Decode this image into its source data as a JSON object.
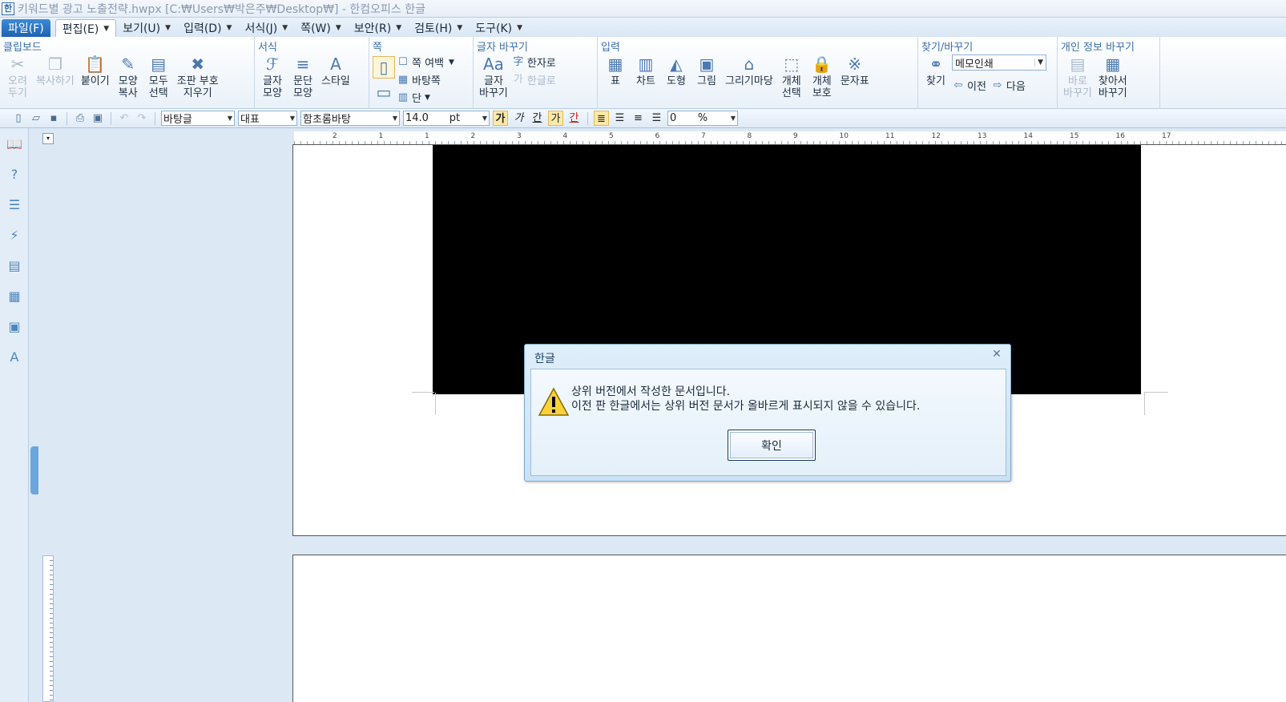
{
  "window": {
    "title": "키워드별 광고 노출전략.hwpx [C:₩Users₩박은주₩Desktop₩] - 한컴오피스 한글",
    "logo": "app-logo-icon"
  },
  "menu": {
    "file": "파일(F)",
    "items": [
      "편집(E)",
      "보기(U)",
      "입력(D)",
      "서식(J)",
      "쪽(W)",
      "보안(R)",
      "검토(H)",
      "도구(K)"
    ]
  },
  "ribbon": {
    "clipboard": {
      "title": "클립보드",
      "buttons": [
        {
          "label": "오려\n두기",
          "icon": "scissors-icon",
          "glyph": "✂"
        },
        {
          "label": "복사하기",
          "icon": "copy-icon",
          "glyph": "❐"
        },
        {
          "label": "붙이기",
          "icon": "paste-icon",
          "glyph": "📋"
        },
        {
          "label": "모양\n복사",
          "icon": "format-painter-icon",
          "glyph": "✎"
        },
        {
          "label": "모두\n선택",
          "icon": "select-all-icon",
          "glyph": "▤"
        },
        {
          "label": "조판 부호\n지우기",
          "icon": "clear-marks-icon",
          "glyph": "✖"
        }
      ]
    },
    "format": {
      "title": "서식",
      "buttons": [
        {
          "label": "글자\n모양",
          "icon": "char-shape-icon",
          "glyph": "ℱ"
        },
        {
          "label": "문단\n모양",
          "icon": "para-shape-icon",
          "glyph": "≡"
        },
        {
          "label": "스타일",
          "icon": "style-icon",
          "glyph": "A"
        }
      ]
    },
    "page": {
      "title": "쪽",
      "margin": "쪽 여백",
      "background": "바탕쪽",
      "columns": "단"
    },
    "char_replace": {
      "title": "글자 바꾸기",
      "button": "글자\n바꾸기",
      "hanja": "한자로",
      "hangul": "한글로"
    },
    "input": {
      "title": "입력",
      "buttons": [
        {
          "label": "표",
          "icon": "table-icon",
          "glyph": "▦"
        },
        {
          "label": "차트",
          "icon": "chart-icon",
          "glyph": "▥"
        },
        {
          "label": "도형",
          "icon": "shape-icon",
          "glyph": "◭"
        },
        {
          "label": "그림",
          "icon": "picture-icon",
          "glyph": "▣"
        },
        {
          "label": "그리기마당",
          "icon": "clipart-icon",
          "glyph": "⌂"
        },
        {
          "label": "개체\n선택",
          "icon": "object-select-icon",
          "glyph": "⬚"
        },
        {
          "label": "개체\n보호",
          "icon": "object-protect-icon",
          "glyph": "🔒"
        },
        {
          "label": "문자표",
          "icon": "symbol-icon",
          "glyph": "※"
        }
      ]
    },
    "find": {
      "title": "찾기/바꾸기",
      "find": "찾기",
      "memo_value": "메모인쇄",
      "prev": "이전",
      "next": "다음"
    },
    "privacy": {
      "title": "개인 정보 바꾸기",
      "direct": "바로\n바꾸기",
      "search": "찾아서\n바꾸기"
    }
  },
  "format_toolbar": {
    "style": "바탕글",
    "lang": "대표",
    "font": "함초롬바탕",
    "size": "14.0",
    "size_unit": "pt",
    "bold": "가",
    "italic": "가",
    "underline": "간",
    "strike": "가",
    "font_color": "간",
    "spacing": "0",
    "spacing_unit": "%"
  },
  "ruler": {
    "numbers": [
      "2",
      "1",
      "1",
      "2",
      "3",
      "4",
      "5",
      "6",
      "7",
      "8",
      "9",
      "10",
      "11",
      "12",
      "13",
      "14",
      "15",
      "16",
      "17"
    ]
  },
  "dialog": {
    "title": "한글",
    "message": "상위 버전에서 작성한 문서입니다.\n이전 판 한글에서는 상위 버전 문서가 올바르게 표시되지 않을 수 있습니다.",
    "ok": "확인"
  },
  "colors": {
    "accent": "#3b6fa8",
    "menu_file_bg": "#1f62b0",
    "workspace_bg": "#dce9f5",
    "dialog_bg": "#d7e9f8"
  }
}
